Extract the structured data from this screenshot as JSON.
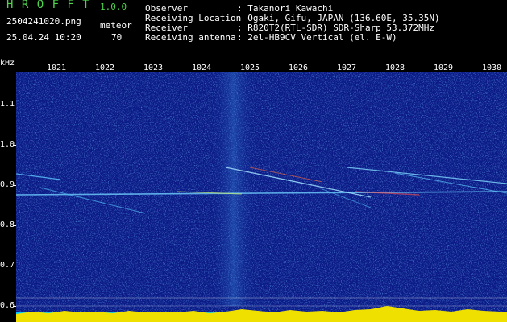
{
  "header": {
    "app_name": "H R O F F T",
    "version": "1.0.0",
    "filename": "2504241020.png",
    "datetime": "25.04.24 10:20",
    "meteor_label": "meteor",
    "meteor_count": "70"
  },
  "info": {
    "rows": [
      {
        "label": "Observer",
        "value": ": Takanori Kawachi"
      },
      {
        "label": "Receiving Location",
        "value": ": Ogaki, Gifu, JAPAN (136.60E, 35.35N)"
      },
      {
        "label": "Receiver",
        "value": ": R820T2(RTL-SDR) SDR-Sharp 53.372MHz"
      },
      {
        "label": "Receiving antenna",
        "value": ": 2el-HB9CV Vertical (el. E-W)"
      }
    ]
  },
  "axes": {
    "y_unit": "kHz",
    "y_ticks": [
      "1.1",
      "1.0",
      "0.9",
      "0.8",
      "0.7",
      "0.6"
    ],
    "x_ticks": [
      "1021",
      "1022",
      "1023",
      "1024",
      "1025",
      "1026",
      "1027",
      "1028",
      "1029",
      "1030"
    ]
  },
  "colors": {
    "background": "#0b1a86",
    "text": "#ffffff",
    "title_green": "#4cd44c",
    "signal": "#2aa7e0",
    "level_yellow": "#f0e000",
    "level_cyan": "#00c8ff"
  }
}
